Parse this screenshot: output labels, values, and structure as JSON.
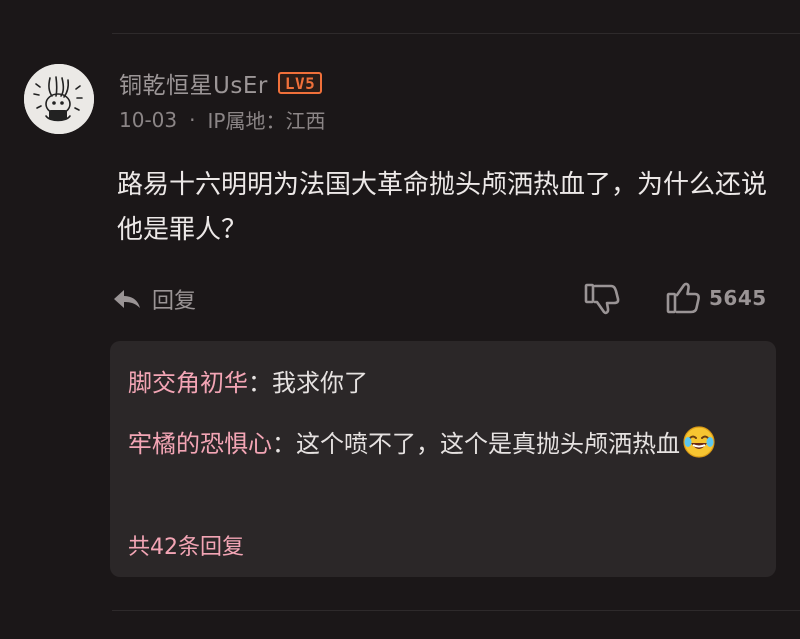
{
  "comment": {
    "username": "铜乾恒星UsEr",
    "level_badge": "LV5",
    "date": "10-03",
    "separator": "·",
    "ip_location": "IP属地：江西",
    "text": "路易十六明明为法国大革命抛头颅洒热血了，为什么还说他是罪人？"
  },
  "actions": {
    "reply_label": "回复",
    "like_count": "5645",
    "icons": [
      "reply-arrow-icon",
      "thumbs-down-icon",
      "thumbs-up-icon"
    ]
  },
  "replies": [
    {
      "author": "脚交角初华",
      "separator": "：",
      "text": "我求你了"
    },
    {
      "author": "牢橘的恐惧心",
      "separator": "：",
      "text": "这个喷不了，这个是真抛头颅洒热血",
      "emoji": "crying-laughing-emoji"
    }
  ],
  "reply_count_label": "共42条回复",
  "colors": {
    "background": "#1b1718",
    "reply_box": "#2b2728",
    "author_pink": "#f3a5b5",
    "badge_orange": "#f0703a"
  }
}
